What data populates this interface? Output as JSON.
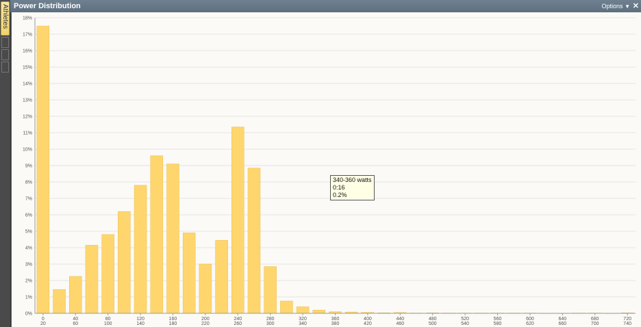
{
  "panel": {
    "title": "Power Distribution",
    "options_label": "Options",
    "close_glyph": "✕"
  },
  "side_tab": {
    "label": "Athletes"
  },
  "tooltip": {
    "line1": "340-360 watts",
    "line2": "0:16",
    "line3": "0.2%"
  },
  "colors": {
    "bar": "#ffd66e",
    "bar_stroke": "#e7bf55",
    "grid": "#e4e4e4"
  },
  "chart_data": {
    "type": "bar",
    "title": "",
    "xlabel": "",
    "ylabel": "",
    "ylim": [
      0,
      18
    ],
    "y_ticks": [
      "0%",
      "1%",
      "2%",
      "3%",
      "4%",
      "5%",
      "6%",
      "7%",
      "8%",
      "9%",
      "10%",
      "11%",
      "12%",
      "13%",
      "14%",
      "15%",
      "16%",
      "17%",
      "18%"
    ],
    "x_tick_labels": [
      [
        "0",
        "20"
      ],
      [
        "40",
        "60"
      ],
      [
        "80",
        "100"
      ],
      [
        "120",
        "140"
      ],
      [
        "160",
        "180"
      ],
      [
        "200",
        "220"
      ],
      [
        "240",
        "260"
      ],
      [
        "280",
        "300"
      ],
      [
        "320",
        "340"
      ],
      [
        "360",
        "380"
      ],
      [
        "400",
        "420"
      ],
      [
        "440",
        "460"
      ],
      [
        "480",
        "500"
      ],
      [
        "520",
        "540"
      ],
      [
        "560",
        "580"
      ],
      [
        "600",
        "620"
      ],
      [
        "640",
        "660"
      ],
      [
        "680",
        "700"
      ],
      [
        "720",
        "740"
      ]
    ],
    "categories": [
      "0-20",
      "20-40",
      "40-60",
      "60-80",
      "80-100",
      "100-120",
      "120-140",
      "140-160",
      "160-180",
      "180-200",
      "200-220",
      "220-240",
      "240-260",
      "260-280",
      "280-300",
      "300-320",
      "320-340",
      "340-360",
      "360-380",
      "380-400",
      "400-420",
      "420-440",
      "440-460",
      "460-480",
      "480-500",
      "500-520",
      "520-540",
      "540-560",
      "560-580",
      "580-600",
      "600-620",
      "620-640",
      "640-660",
      "660-680",
      "680-700",
      "700-720",
      "720-740"
    ],
    "values": [
      17.5,
      1.45,
      2.25,
      4.15,
      4.8,
      6.2,
      7.8,
      9.6,
      9.1,
      4.9,
      3.0,
      4.45,
      11.35,
      8.85,
      2.85,
      0.75,
      0.4,
      0.2,
      0.1,
      0.08,
      0.06,
      0.03,
      0.05,
      0.02,
      0.03,
      0.02,
      0.02,
      0.02,
      0.02,
      0.02,
      0.02,
      0.01,
      0.01,
      0.02,
      0.02,
      0.01,
      0.03
    ]
  }
}
